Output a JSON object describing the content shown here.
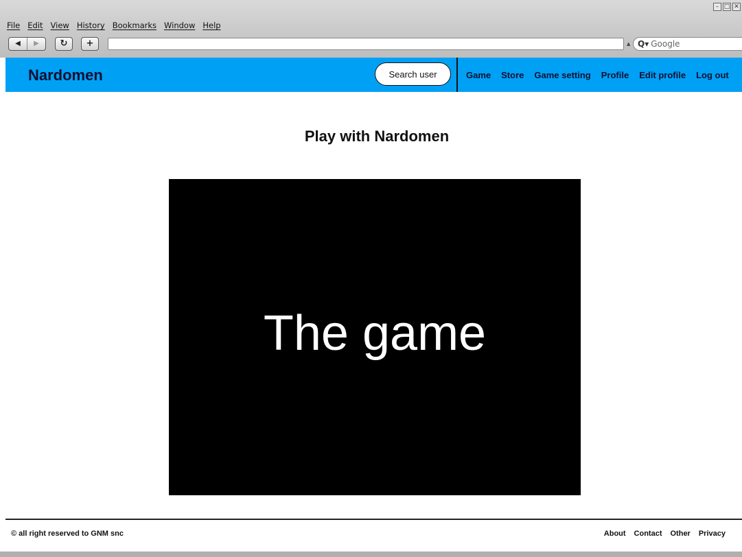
{
  "browser": {
    "window_controls": [
      "minimize-icon",
      "maximize-icon",
      "close-icon"
    ],
    "menu": [
      "File",
      "Edit",
      "View",
      "History",
      "Bookmarks",
      "Window",
      "Help"
    ],
    "url": "",
    "search_placeholder": "Google"
  },
  "header": {
    "brand": "Nardomen",
    "search_button": "Search user",
    "nav": [
      "Game",
      "Store",
      "Game setting",
      "Profile",
      "Edit profile",
      "Log out"
    ],
    "bg_color": "#00a0f5"
  },
  "main": {
    "title": "Play with Nardomen",
    "game_text": "The game"
  },
  "footer": {
    "copyright": "© all right reserved to GNM snc",
    "links": [
      "About",
      "Contact",
      "Other",
      "Privacy"
    ]
  }
}
